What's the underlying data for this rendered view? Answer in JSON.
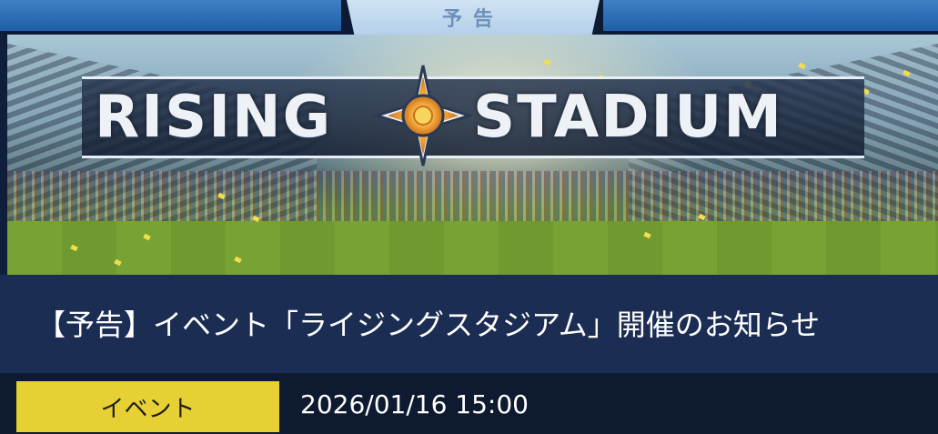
{
  "header": {
    "label": "予告"
  },
  "banner": {
    "logo_left": "RISING",
    "logo_right": "STADIUM"
  },
  "notice": {
    "title": "【予告】イベント「ライジングスタジアム」開催のお知らせ",
    "category": "イベント",
    "datetime": "2026/01/16 15:00",
    "category_color": "#e6d033"
  }
}
